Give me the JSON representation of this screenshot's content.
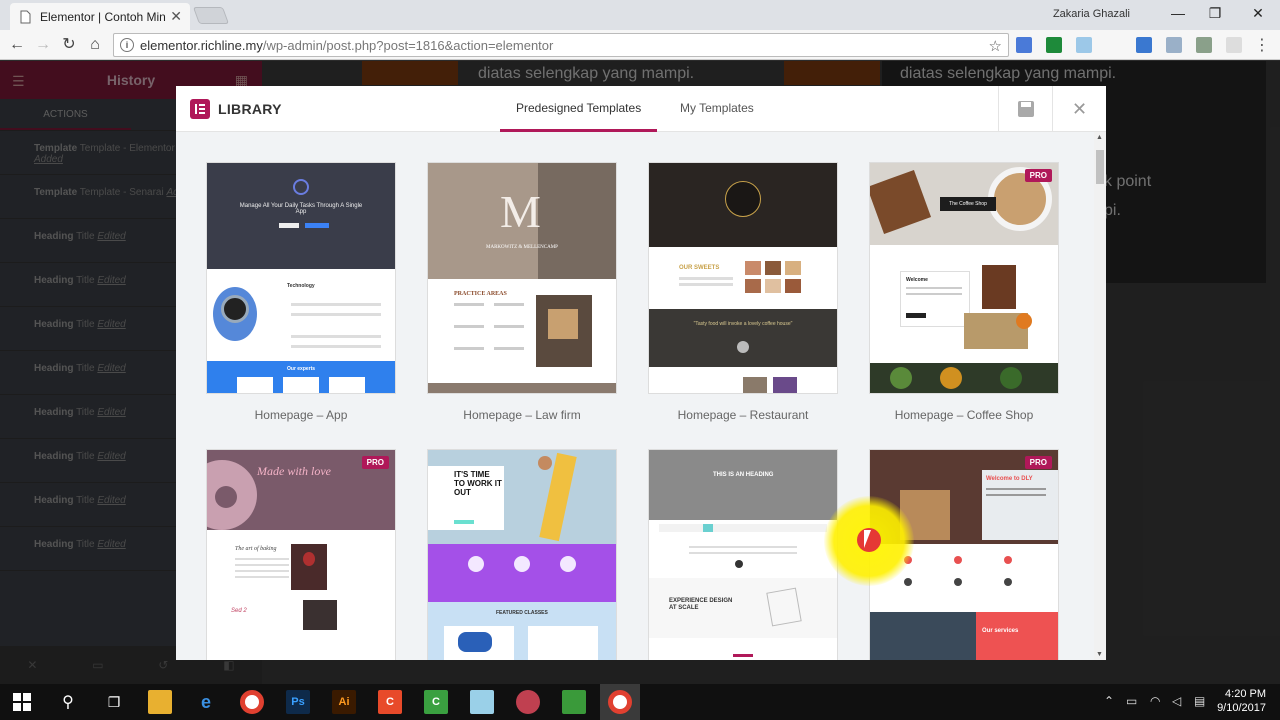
{
  "browser": {
    "tab_title": "Elementor | Contoh Mini",
    "url_host": "elementor.richline.my",
    "url_path": "/wp-admin/post.php?post=1816&action=elementor",
    "profile_name": "Zakaria Ghazali"
  },
  "editor": {
    "panel_title": "History",
    "tab_actions": "ACTIONS",
    "history": [
      {
        "type": "Template",
        "desc": "Template - Elementor",
        "state": "Popular Added"
      },
      {
        "type": "Template",
        "desc": "Template - Senarai",
        "state": "Added"
      },
      {
        "type": "Heading",
        "desc": "Title",
        "state": "Edited"
      },
      {
        "type": "Heading",
        "desc": "Title",
        "state": "Edited"
      },
      {
        "type": "Heading",
        "desc": "Title",
        "state": "Edited"
      },
      {
        "type": "Heading",
        "desc": "Title",
        "state": "Edited"
      },
      {
        "type": "Heading",
        "desc": "Title",
        "state": "Edited"
      },
      {
        "type": "Heading",
        "desc": "Title",
        "state": "Edited"
      },
      {
        "type": "Heading",
        "desc": "Title",
        "state": "Edited"
      },
      {
        "type": "Heading",
        "desc": "Title",
        "state": "Edited"
      }
    ],
    "preview_text_1": "diatas selengkap yang mampi.",
    "preview_text_2": "diatas selengkap yang mampi.",
    "preview_text_3": "k point",
    "preview_text_4": "pi."
  },
  "library": {
    "title": "LIBRARY",
    "tabs": [
      "Predesigned Templates",
      "My Templates"
    ],
    "active_tab": 0,
    "templates": [
      {
        "name": "Homepage – App",
        "pro": false
      },
      {
        "name": "Homepage – Law firm",
        "pro": false
      },
      {
        "name": "Homepage – Restaurant",
        "pro": false
      },
      {
        "name": "Homepage – Coffee Shop",
        "pro": true
      },
      {
        "name": "",
        "pro": true
      },
      {
        "name": "",
        "pro": false
      },
      {
        "name": "",
        "pro": false
      },
      {
        "name": "",
        "pro": true
      }
    ],
    "pro_label": "PRO",
    "thumb_text": {
      "app_headline": "Manage All Your Daily Tasks Through A Single App",
      "app_section": "Technology",
      "app_experts": "Our experts",
      "law_firm": "MARKOWITZ & MELLENCAMP",
      "law_practice": "PRACTICE AREAS",
      "restaurant_sweets": "OUR SWEETS",
      "restaurant_quote": "\"Tasty food will invoke a lovely coffee house\"",
      "coffee_title": "The Coffee Shop",
      "coffee_welcome": "Welcome",
      "donut_title": "Made with love",
      "donut_sub": "The art of baking",
      "fitness_title": "IT'S TIME TO WORK IT OUT",
      "fitness_classes": "FEATURED CLASSES",
      "heading_title": "THIS IS AN HEADING",
      "heading_design": "EXPERIENCE DESIGN AT SCALE",
      "delivery_title": "Welcome to DLY",
      "delivery_services": "Our services"
    }
  },
  "taskbar": {
    "time": "4:20 PM",
    "date": "9/10/2017"
  },
  "colors": {
    "elementor_pink": "#b01859",
    "editor_header": "#7a1838"
  }
}
